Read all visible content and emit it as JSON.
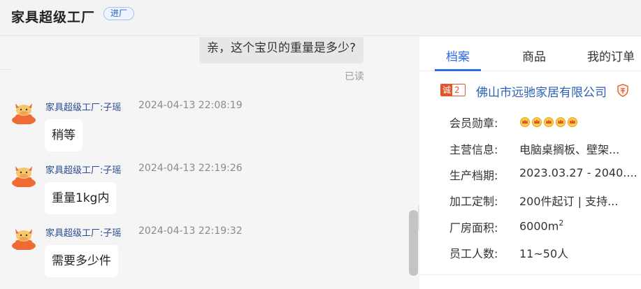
{
  "header": {
    "title": "家具超级工厂",
    "badge": "进厂"
  },
  "chat": {
    "outgoing": {
      "text": "亲，这个宝贝的重量是多少?",
      "status": "已读"
    },
    "messages": [
      {
        "sender": "家具超级工厂:子瑶",
        "time": "2024-04-13 22:08:19",
        "text": "稍等"
      },
      {
        "sender": "家具超级工厂:子瑶",
        "time": "2024-04-13 22:19:26",
        "text": "重量1kg内"
      },
      {
        "sender": "家具超级工厂:子瑶",
        "time": "2024-04-13 22:19:32",
        "text": "需要多少件"
      }
    ],
    "collapse_icon": "»"
  },
  "panel": {
    "tabs": [
      "档案",
      "商品",
      "我的订单"
    ],
    "active_tab": "档案",
    "company": {
      "badge_main": "诚",
      "badge_years": "2年",
      "name": "佛山市远驰家居有限公司",
      "verify_icon": "shield-icon"
    },
    "info": [
      {
        "label": "会员勋章:",
        "value": ""
      },
      {
        "label": "主营信息:",
        "value": "电脑桌搁板、壁架..."
      },
      {
        "label": "生产档期:",
        "value": "2023.03.27 - 2040...."
      },
      {
        "label": "加工定制:",
        "value": "200件起订 | 支持..."
      },
      {
        "label": "厂房面积:",
        "value": "6000m",
        "value_sup": "2"
      },
      {
        "label": "员工人数:",
        "value": "11~50人"
      }
    ],
    "medal_count": 5
  },
  "colors": {
    "accent": "#2e6be6",
    "company_link": "#2c5fb5",
    "sender": "#2b4a95",
    "cheng_badge": "#e2542b"
  }
}
